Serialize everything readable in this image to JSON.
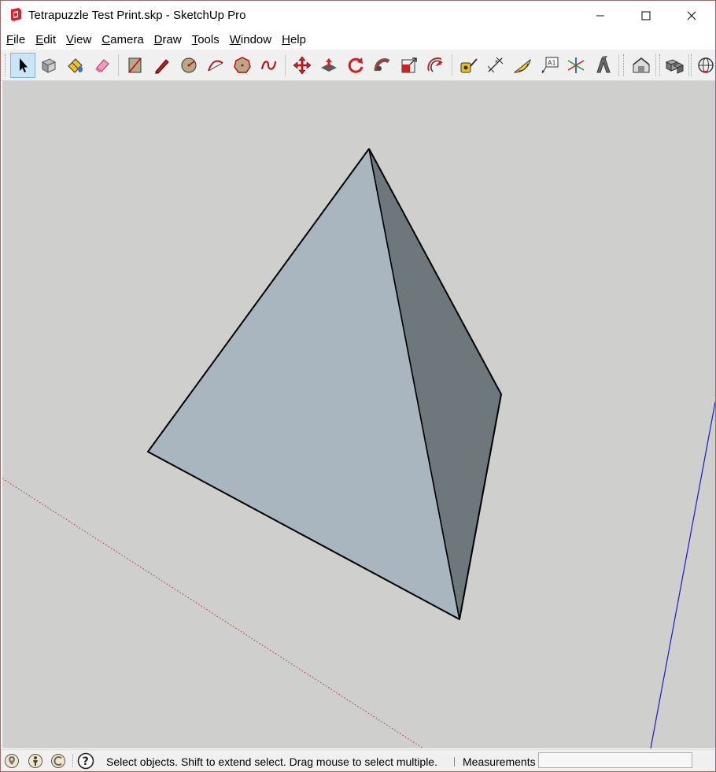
{
  "window": {
    "title": "Tetrapuzzle Test Print.skp - SketchUp Pro"
  },
  "menu": [
    {
      "mnemonic": "F",
      "rest": "ile"
    },
    {
      "mnemonic": "E",
      "rest": "dit"
    },
    {
      "mnemonic": "V",
      "rest": "iew"
    },
    {
      "mnemonic": "C",
      "rest": "amera"
    },
    {
      "mnemonic": "D",
      "rest": "raw"
    },
    {
      "mnemonic": "T",
      "rest": "ools"
    },
    {
      "mnemonic": "W",
      "rest": "indow"
    },
    {
      "mnemonic": "H",
      "rest": "elp"
    }
  ],
  "toolbar": {
    "active_tool": "select",
    "tools": [
      "select",
      "make-component",
      "paint-bucket",
      "eraser",
      "rectangle",
      "line",
      "circle",
      "arc",
      "polygon",
      "freehand",
      "move",
      "push-pull",
      "rotate",
      "follow-me",
      "scale",
      "offset",
      "tape-measure",
      "dimension",
      "protractor",
      "text",
      "axes",
      "3d-text",
      "warehouse",
      "extension-warehouse",
      "orbit"
    ]
  },
  "model": {
    "front_face_color": "#a9b6bf",
    "side_face_color": "#6d777c",
    "edge_color": "#000000",
    "background_color": "#cfcfcd",
    "red_axis_color": "#b03030",
    "blue_axis_color": "#1a1acc"
  },
  "status": {
    "message": "Select objects. Shift to extend select. Drag mouse to select multiple.",
    "measurements_label": "Measurements",
    "measurements_value": ""
  }
}
